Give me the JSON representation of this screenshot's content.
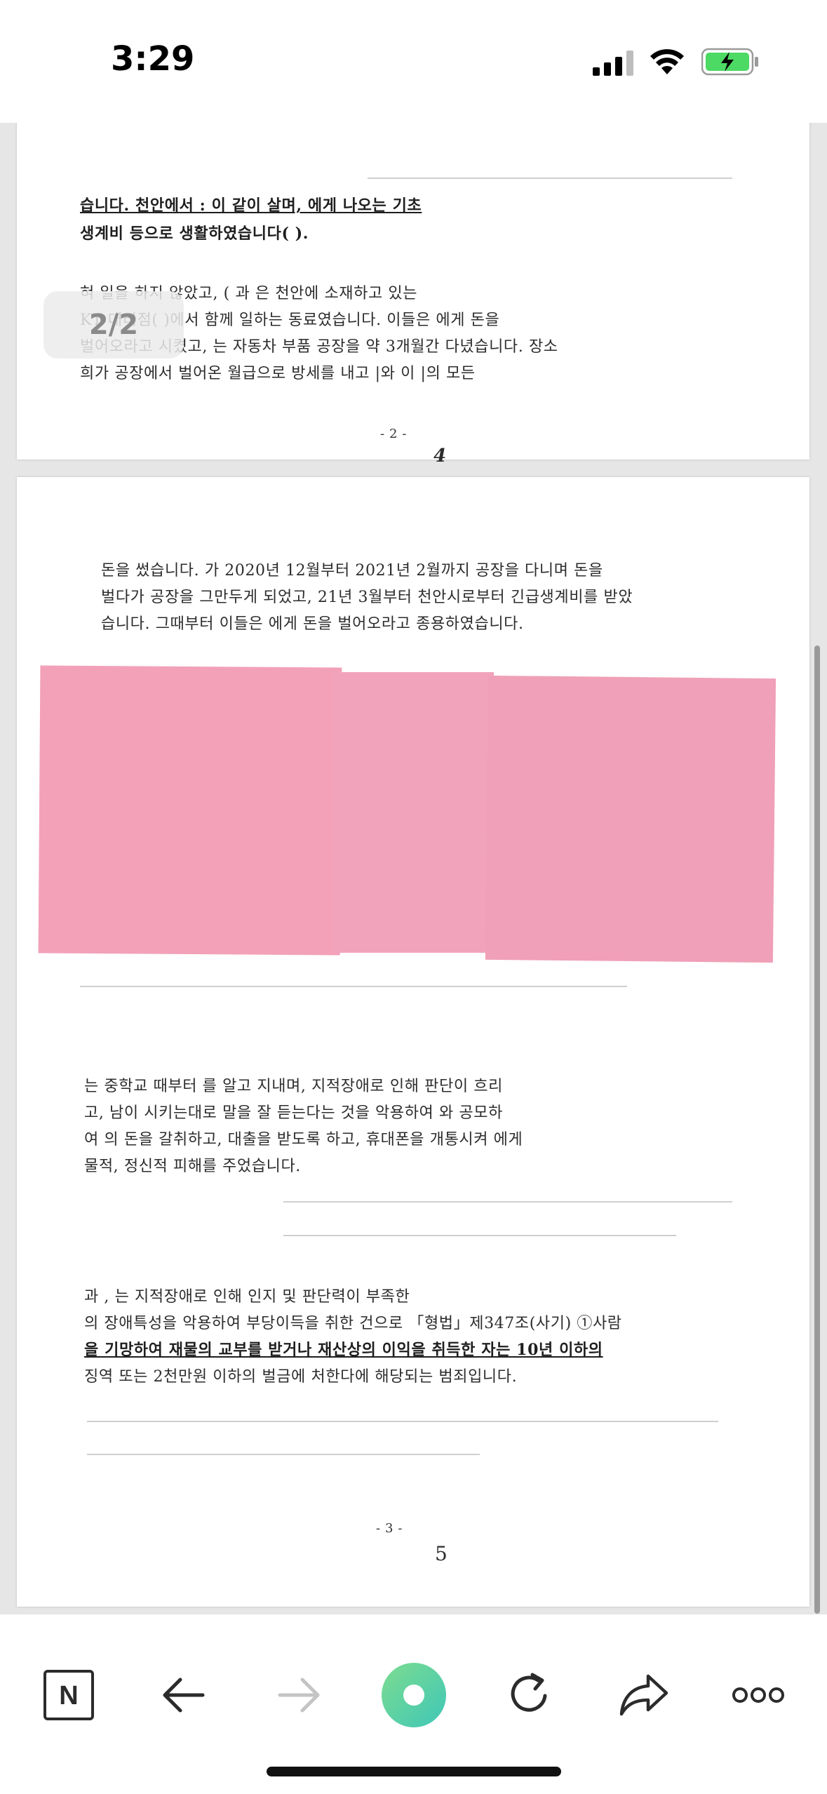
{
  "status_bar": {
    "time": "3:29"
  },
  "viewer": {
    "page_indicator": "2/2",
    "page1": {
      "lines": [
        "습니다. 천안에서 :                 이 같이 살며,        에게 나오는 기초",
        "생계비 등으로 생활하였습니다(                              ).",
        "        혀 일을 하지 않았고, (     과        은 천안에 소재하고 있는",
        "KT 대리점(          )에서 함께 일하는 동료였습니다. 이들은        에게 돈을",
        "벌어오라고 시켰고,           는 자동차 부품 공장을 약 3개월간 다녔습니다. 장소",
        "희가 공장에서 벌어온 월급으로 방세를 내고          |와          이          |의 모든"
      ],
      "page_number": "- 2 -",
      "stamp_number": "4"
    },
    "page2": {
      "lines_top": [
        "돈을 썼습니다.           가 2020년 12월부터 2021년 2월까지 공장을 다니며 돈을",
        "벌다가 공장을 그만두게 되었고, 21년 3월부터 천안시로부터 긴급생계비를 받았",
        "습니다. 그때부터 이들은             에게 돈을 벌어오라고 종용하였습니다."
      ],
      "lines_mid": [
        "         는 중학교 때부터          를 알고 지내며, 지적장애로 인해 판단이 흐리",
        "고, 남이 시키는대로 말을 잘 듣는다는 것을 악용하여                        와 공모하",
        "여         의 돈을 갈취하고, 대출을 받도록 하고, 휴대폰을 개통시켜        에게",
        "물적, 정신적 피해를 주었습니다."
      ],
      "lines_law": [
        "         과          ,         는 지적장애로 인해 인지 및 판단력이 부족한",
        "의 장애특성을 악용하여 부당이득을 취한 건으로 「형법」제347조(사기) ①사람",
        "을 기망하여 재물의 교부를 받거나 재산상의 이익을 취득한 자는 10년 이하의",
        "징역 또는 2천만원 이하의 벌금에 처한다에 해당되는 범죄입니다."
      ],
      "page_number": "- 3 -",
      "stamp_number": "5"
    }
  },
  "colors": {
    "redaction_pink": "#f2a1b9",
    "record_button_start": "#7ddc8f",
    "record_button_end": "#3fc7b8",
    "battery_green": "#4cd964"
  },
  "toolbar": {
    "icons": [
      "naver-n-icon",
      "back-arrow-icon",
      "forward-arrow-icon",
      "record-button-icon",
      "refresh-icon",
      "share-icon",
      "more-icon"
    ],
    "naver_label": "N"
  }
}
